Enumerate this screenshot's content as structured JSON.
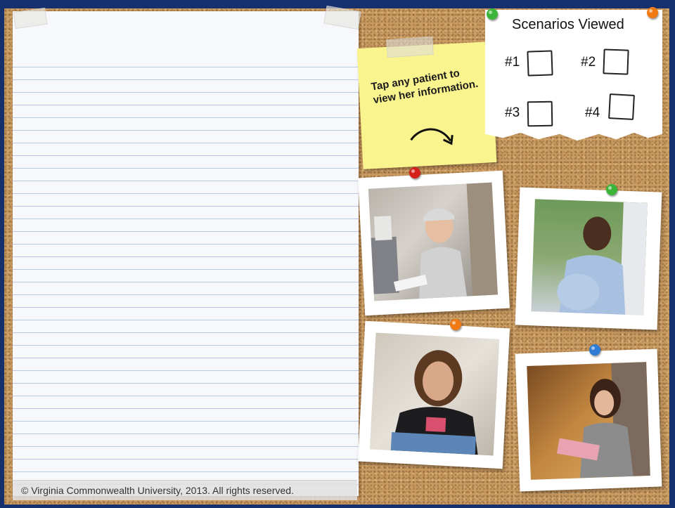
{
  "sticky_note": {
    "text": "Tap any patient to view her information."
  },
  "scenarios": {
    "title": "Scenarios Viewed",
    "items": [
      {
        "label": "#1",
        "checked": false
      },
      {
        "label": "#2",
        "checked": false
      },
      {
        "label": "#3",
        "checked": false
      },
      {
        "label": "#4",
        "checked": false
      }
    ]
  },
  "footer": {
    "copyright": "© Virginia Commonwealth University, 2013.  All rights reserved."
  },
  "colors": {
    "frame": "#16306e",
    "cork": "#c99a61",
    "sticky": "#f9f48e",
    "pin_red": "#d6201c",
    "pin_green": "#3cb43a",
    "pin_orange": "#f07a13",
    "pin_blue": "#2f7bd6"
  },
  "patients": [
    {
      "icon": "patient-photo-icon"
    },
    {
      "icon": "patient-photo-icon"
    },
    {
      "icon": "patient-photo-icon"
    },
    {
      "icon": "patient-photo-icon"
    }
  ]
}
